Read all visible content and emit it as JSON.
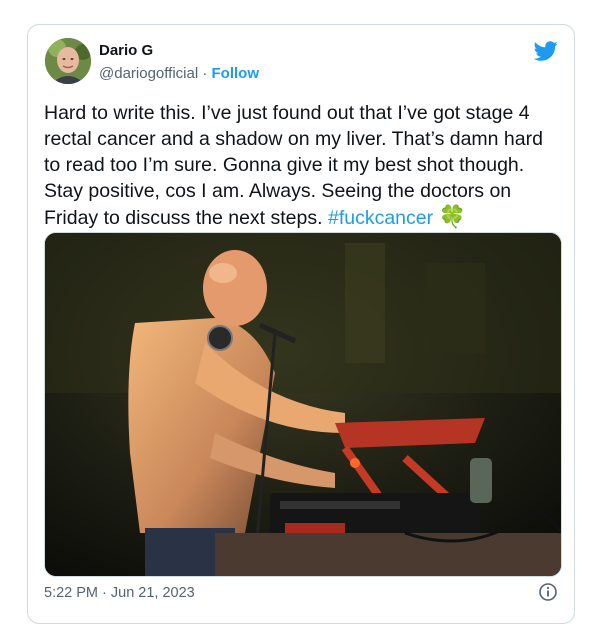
{
  "tweet": {
    "author_name": "Dario G",
    "handle": "@dariogofficial",
    "separator": "·",
    "follow_label": "Follow",
    "text_main": "Hard to write this. I’ve just found out that I’ve got stage 4 rectal cancer and a shadow on my liver. That’s damn hard to read too I’m sure. Gonna give it my best shot though. Stay positive, cos I am. Always. Seeing the doctors on Friday to discuss the next steps. ",
    "hashtag": "#fuckcancer",
    "emoji": "🍀",
    "timestamp": "5:22 PM · Jun 21, 2023"
  },
  "icons": {
    "brand": "twitter-bird-icon",
    "info": "info-icon"
  },
  "colors": {
    "link": "#1d9bf0",
    "text": "#0f1419",
    "muted": "#536471",
    "border": "#cfd9de"
  }
}
